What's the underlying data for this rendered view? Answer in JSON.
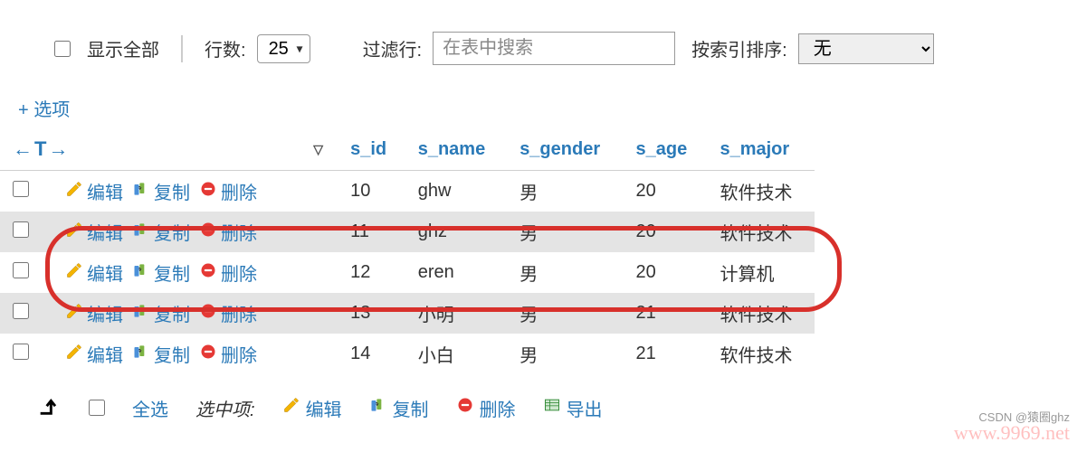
{
  "toolbar": {
    "show_all_label": "显示全部",
    "rows_label": "行数:",
    "rows_value": "25",
    "filter_label": "过滤行:",
    "filter_placeholder": "在表中搜索",
    "sort_label": "按索引排序:",
    "sort_value": "无"
  },
  "options_link": "+ 选项",
  "header_actions_symbol": "←T→",
  "columns": [
    "s_id",
    "s_name",
    "s_gender",
    "s_age",
    "s_major"
  ],
  "row_actions": {
    "edit": "编辑",
    "copy": "复制",
    "delete": "删除"
  },
  "rows": [
    {
      "s_id": "10",
      "s_name": "ghw",
      "s_gender": "男",
      "s_age": "20",
      "s_major": "软件技术"
    },
    {
      "s_id": "11",
      "s_name": "ghz",
      "s_gender": "男",
      "s_age": "20",
      "s_major": "软件技术"
    },
    {
      "s_id": "12",
      "s_name": "eren",
      "s_gender": "男",
      "s_age": "20",
      "s_major": "计算机"
    },
    {
      "s_id": "13",
      "s_name": "小明",
      "s_gender": "男",
      "s_age": "21",
      "s_major": "软件技术"
    },
    {
      "s_id": "14",
      "s_name": "小白",
      "s_gender": "男",
      "s_age": "21",
      "s_major": "软件技术"
    }
  ],
  "footer": {
    "select_all": "全选",
    "checked_label": "选中项:",
    "edit": "编辑",
    "copy": "复制",
    "delete": "删除",
    "export": "导出"
  },
  "watermark1": "CSDN @猿圈ghz",
  "watermark2": "www.9969.net"
}
